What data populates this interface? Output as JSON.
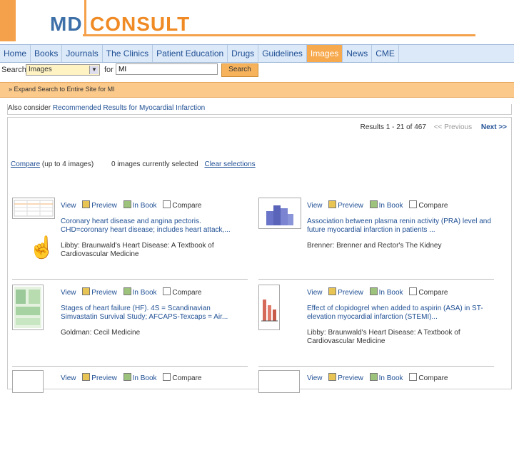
{
  "brand": {
    "part1": "MD",
    "part2": "CONSULT"
  },
  "nav": {
    "tabs": [
      "Home",
      "Books",
      "Journals",
      "The Clinics",
      "Patient Education",
      "Drugs",
      "Guidelines",
      "Images",
      "News",
      "CME"
    ],
    "active": "Images"
  },
  "search": {
    "label": "Search",
    "scope": "Images",
    "for_label": "for",
    "query": "MI",
    "button": "Search"
  },
  "expand": {
    "text": "» Expand Search to Entire Site for MI"
  },
  "consider": {
    "prefix": "Also consider",
    "link": "Recommended Results for Myocardial Infarction"
  },
  "pager": {
    "prefix": "Results",
    "range": "1 - 21",
    "of": "of 467",
    "prev": "<< Previous",
    "next": "Next >>"
  },
  "compare": {
    "link": "Compare",
    "hint": "(up to 4 images)",
    "selected": "0 images currently selected",
    "clear": "Clear selections"
  },
  "actions": {
    "view": "View",
    "preview": "Preview",
    "inbook": "In Book",
    "compare": "Compare"
  },
  "items": [
    {
      "desc": "Coronary heart disease and angina pectoris. CHD=coronary heart disease; includes heart attack,...",
      "source": "Libby: Braunwald's Heart Disease: A Textbook of Cardiovascular Medicine"
    },
    {
      "desc": "Association between plasma renin activity (PRA) level and future myocardial infarction in patients ...",
      "source": "Brenner: Brenner and Rector's The Kidney"
    },
    {
      "desc": "Stages of heart failure (HF). 4S = Scandinavian Simvastatin Survival Study; AFCAPS-Texcaps = Air...",
      "source": "Goldman: Cecil Medicine"
    },
    {
      "desc": "Effect of clopidogrel when added to aspirin (ASA) in ST-elevation myocardial infarction (STEMI)...",
      "source": "Libby: Braunwald's Heart Disease: A Textbook of Cardiovascular Medicine"
    }
  ],
  "colors": {
    "accent": "#f5a04a",
    "link": "#1f4f94",
    "nav_bg": "#dce9f8"
  }
}
